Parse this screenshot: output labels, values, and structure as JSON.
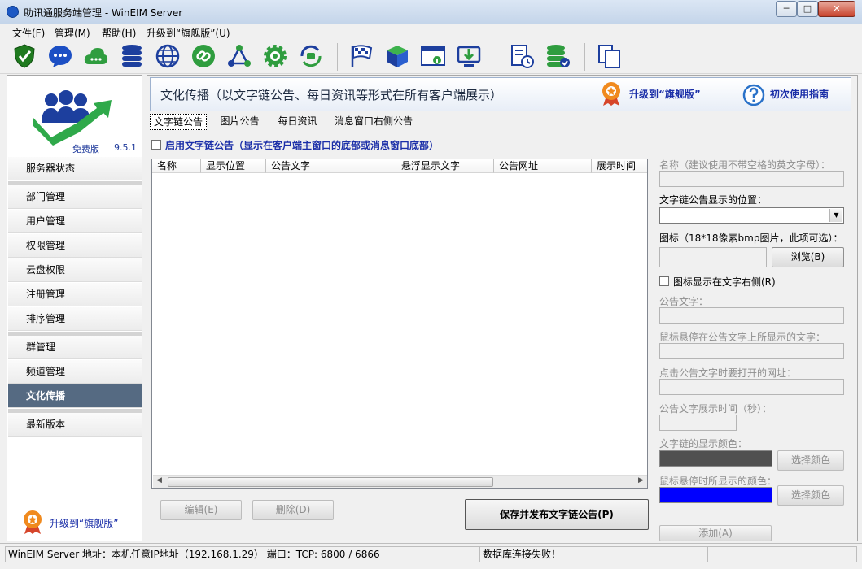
{
  "window": {
    "title": "助讯通服务端管理 - WinEIM Server",
    "min_label": "─",
    "max_label": "□",
    "close_label": "✕"
  },
  "menu": {
    "file": "文件(F)",
    "manage": "管理(M)",
    "help": "帮助(H)",
    "upgrade": "升级到“旗舰版”(U)"
  },
  "toolbar": {
    "icons": [
      "shield-check-icon",
      "chat-bubble-icon",
      "cloud-icon",
      "database-icon",
      "globe-icon",
      "link-icon",
      "network-nodes-icon",
      "gear-icon",
      "sync-chat-icon",
      "race-flag-icon",
      "cube-icon",
      "browser-info-icon",
      "monitor-download-icon",
      "document-clock-icon",
      "database-check-icon",
      "copy-pages-icon"
    ]
  },
  "sidebar": {
    "edition": "免费版",
    "version": "9.5.1",
    "items": [
      "服务器状态",
      "部门管理",
      "用户管理",
      "权限管理",
      "云盘权限",
      "注册管理",
      "排序管理",
      "群管理",
      "频道管理",
      "文化传播",
      "最新版本"
    ],
    "active": "文化传播",
    "upgrade_label": "升级到“旗舰版”"
  },
  "header": {
    "title": "文化传播（以文字链公告、每日资讯等形式在所有客户端展示）",
    "upgrade_label": "升级到“旗舰版”",
    "guide_label": "初次使用指南"
  },
  "tabs": [
    "文字链公告",
    "图片公告",
    "每日资讯",
    "消息窗口右侧公告"
  ],
  "enable_label": "启用文字链公告（显示在客户端主窗口的底部或消息窗口底部）",
  "table": {
    "columns": [
      "名称",
      "显示位置",
      "公告文字",
      "悬浮显示文字",
      "公告网址",
      "展示时间"
    ]
  },
  "buttons": {
    "edit": "编辑(E)",
    "delete": "删除(D)",
    "publish": "保存并发布文字链公告(P)",
    "browse": "浏览(B)",
    "choose_color_1": "选择颜色",
    "choose_color_2": "选择颜色",
    "add": "添加(A)"
  },
  "form": {
    "name_label": "名称（建议使用不带空格的英文字母）：",
    "position_label": "文字链公告显示的位置：",
    "icon_label": "图标（18*18像素bmp图片，此项可选）：",
    "icon_right_label": "图标显示在文字右侧(R)",
    "text_label": "公告文字：",
    "hover_label": "鼠标悬停在公告文字上所显示的文字：",
    "url_label": "点击公告文字时要打开的网址：",
    "time_label": "公告文字展示时间（秒）：",
    "color_label": "文字链的显示颜色：",
    "hover_color_label": "鼠标悬停时所显示的颜色：",
    "text_color": "#505050",
    "hover_color": "#0000ff"
  },
  "status": {
    "address": "WinEIM Server 地址：本机任意IP地址（192.168.1.29）  端口：TCP: 6800 / 6866",
    "db": "数据库连接失败！"
  }
}
